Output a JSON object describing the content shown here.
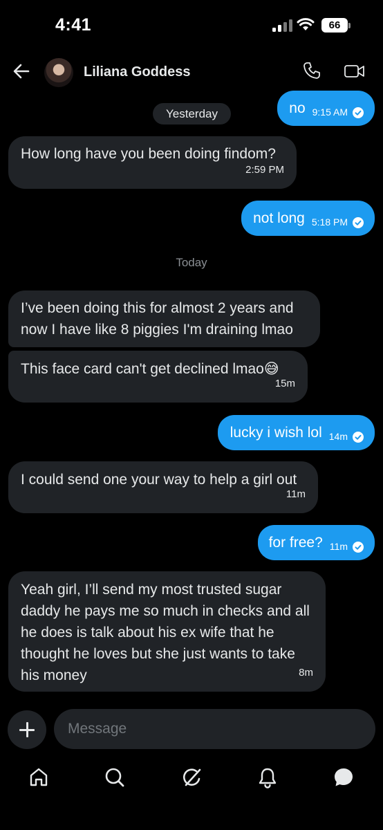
{
  "status_bar": {
    "time": "4:41",
    "battery": "66"
  },
  "header": {
    "contact_name": "Liliana Goddess"
  },
  "dates": {
    "yesterday": "Yesterday",
    "today": "Today"
  },
  "messages": [
    {
      "direction": "out",
      "text": "no",
      "time": "9:15 AM",
      "read": true
    },
    {
      "direction": "in",
      "text": "How long have you been doing findom?",
      "time": "2:59 PM"
    },
    {
      "direction": "out",
      "text": "not long",
      "time": "5:18 PM",
      "read": true
    },
    {
      "direction": "in",
      "text": "I’ve been doing this for almost 2 years and now I have like 8 piggies I'm draining lmao"
    },
    {
      "direction": "in",
      "text": "This face card can't get declined lmao😅",
      "time": "15m"
    },
    {
      "direction": "out",
      "text": "lucky i wish lol",
      "time": "14m",
      "read": true
    },
    {
      "direction": "in",
      "text": "I could send one your way to help a girl out",
      "time": "11m"
    },
    {
      "direction": "out",
      "text": "for free?",
      "time": "11m",
      "read": true
    },
    {
      "direction": "in",
      "text": "Yeah girl, I’ll send my most trusted sugar daddy he pays  me so much in checks and all he does is talk about his ex wife that he thought he loves but she just wants to take his money",
      "time": "8m"
    }
  ],
  "composer": {
    "placeholder": "Message"
  },
  "bottom_nav": {
    "icons": [
      "home-icon",
      "search-icon",
      "grok-icon",
      "notifications-icon",
      "messages-icon"
    ]
  },
  "colors": {
    "background": "#000000",
    "incoming_bubble": "#202327",
    "outgoing_bubble": "#1d9bf0",
    "muted_text": "#8b8f94"
  }
}
